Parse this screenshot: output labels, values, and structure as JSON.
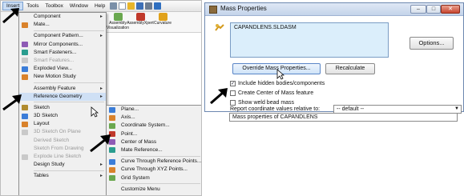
{
  "menubar": {
    "items": [
      "Insert",
      "Tools",
      "Toolbox",
      "Window",
      "Help"
    ],
    "active": "Insert"
  },
  "ribbon": {
    "buttons": [
      {
        "label": "Assembly Visualization",
        "icon": "assembly-visualization-icon",
        "color": "#6aa84f"
      },
      {
        "label": "AssemblyXpert",
        "icon": "assemblyxpert-icon",
        "color": "#c0392b"
      },
      {
        "label": "Curvature",
        "icon": "curvature-icon",
        "color": "#e1a21b"
      }
    ]
  },
  "insert_menu": {
    "items": [
      {
        "type": "item",
        "label": "Component",
        "icon": "",
        "submenu": true,
        "disabled": false
      },
      {
        "type": "item",
        "label": "Mate...",
        "icon": "mate-icon",
        "submenu": false,
        "disabled": false
      },
      {
        "type": "sep"
      },
      {
        "type": "item",
        "label": "Component Pattern...",
        "icon": "",
        "submenu": true,
        "disabled": false
      },
      {
        "type": "item",
        "label": "Mirror Components...",
        "icon": "mirror-components-icon",
        "submenu": false,
        "disabled": false
      },
      {
        "type": "item",
        "label": "Smart Fasteners...",
        "icon": "smart-fasteners-icon",
        "submenu": false,
        "disabled": false
      },
      {
        "type": "item",
        "label": "Smart Features...",
        "icon": "smart-features-icon",
        "submenu": false,
        "disabled": true
      },
      {
        "type": "item",
        "label": "Exploded View...",
        "icon": "exploded-view-icon",
        "submenu": false,
        "disabled": false
      },
      {
        "type": "item",
        "label": "New Motion Study",
        "icon": "motion-study-icon",
        "submenu": false,
        "disabled": false
      },
      {
        "type": "sep"
      },
      {
        "type": "item",
        "label": "Assembly Feature",
        "icon": "",
        "submenu": true,
        "disabled": false
      },
      {
        "type": "item",
        "label": "Reference Geometry",
        "icon": "",
        "submenu": true,
        "disabled": false,
        "highlight": true
      },
      {
        "type": "sep"
      },
      {
        "type": "item",
        "label": "Sketch",
        "icon": "sketch-icon",
        "submenu": false,
        "disabled": false
      },
      {
        "type": "item",
        "label": "3D Sketch",
        "icon": "3d-sketch-icon",
        "submenu": false,
        "disabled": false
      },
      {
        "type": "item",
        "label": "Layout",
        "icon": "layout-icon",
        "submenu": false,
        "disabled": false
      },
      {
        "type": "item",
        "label": "3D Sketch On Plane",
        "icon": "3d-sketch-plane-icon",
        "submenu": false,
        "disabled": true
      },
      {
        "type": "item",
        "label": "Derived Sketch",
        "icon": "",
        "submenu": false,
        "disabled": true
      },
      {
        "type": "item",
        "label": "Sketch From Drawing",
        "icon": "",
        "submenu": false,
        "disabled": true
      },
      {
        "type": "item",
        "label": "Explode Line Sketch",
        "icon": "explode-line-icon",
        "submenu": false,
        "disabled": true
      },
      {
        "type": "item",
        "label": "Design Study",
        "icon": "",
        "submenu": true,
        "disabled": false
      },
      {
        "type": "sep"
      },
      {
        "type": "item",
        "label": "Tables",
        "icon": "",
        "submenu": true,
        "disabled": false
      }
    ]
  },
  "refgeom_menu": {
    "items": [
      {
        "type": "item",
        "label": "Plane...",
        "icon": "plane-icon"
      },
      {
        "type": "item",
        "label": "Axis...",
        "icon": "axis-icon"
      },
      {
        "type": "item",
        "label": "Coordinate System...",
        "icon": "coordinate-system-icon"
      },
      {
        "type": "item",
        "label": "Point...",
        "icon": "point-icon"
      },
      {
        "type": "item",
        "label": "Center of Mass",
        "icon": "center-of-mass-icon"
      },
      {
        "type": "item",
        "label": "Mate Reference...",
        "icon": "mate-reference-icon"
      },
      {
        "type": "sep"
      },
      {
        "type": "item",
        "label": "Curve Through Reference Points...",
        "icon": "curve-ref-points-icon"
      },
      {
        "type": "item",
        "label": "Curve Through XYZ Points...",
        "icon": "curve-xyz-points-icon"
      },
      {
        "type": "item",
        "label": "Grid System",
        "icon": "grid-system-icon"
      },
      {
        "type": "sep"
      },
      {
        "type": "item",
        "label": "Customize Menu",
        "icon": ""
      }
    ]
  },
  "dialog": {
    "title": "Mass Properties",
    "file": "CAPANDLENS.SLDASM",
    "options_label": "Options...",
    "override_label": "Override Mass Properties...",
    "recalc_label": "Recalculate",
    "checkboxes": [
      {
        "label": "Include hidden bodies/components",
        "checked": true
      },
      {
        "label": "Create Center of Mass feature",
        "checked": false
      },
      {
        "label": "Show weld bead mass",
        "checked": false
      }
    ],
    "report_label": "Report coordinate values relative to:",
    "report_value": "-- default --",
    "results_label": "Mass properties of CAPANDLENS"
  }
}
